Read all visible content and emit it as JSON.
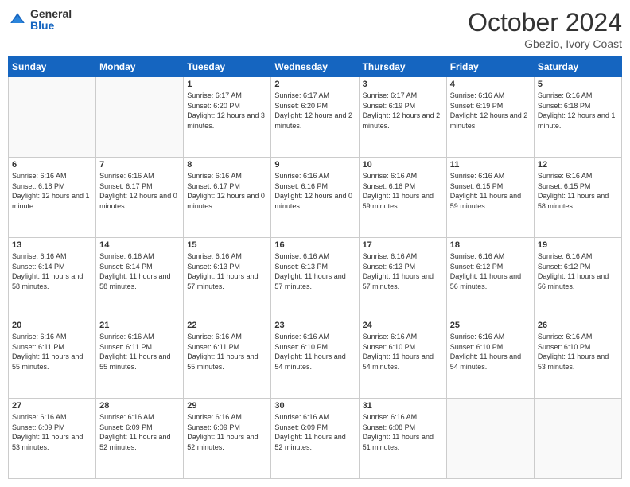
{
  "header": {
    "logo_general": "General",
    "logo_blue": "Blue",
    "month_title": "October 2024",
    "subtitle": "Gbezio, Ivory Coast"
  },
  "weekdays": [
    "Sunday",
    "Monday",
    "Tuesday",
    "Wednesday",
    "Thursday",
    "Friday",
    "Saturday"
  ],
  "weeks": [
    [
      {
        "day": "",
        "empty": true
      },
      {
        "day": "",
        "empty": true
      },
      {
        "day": "1",
        "sunrise": "6:17 AM",
        "sunset": "6:20 PM",
        "daylight": "12 hours and 3 minutes."
      },
      {
        "day": "2",
        "sunrise": "6:17 AM",
        "sunset": "6:20 PM",
        "daylight": "12 hours and 2 minutes."
      },
      {
        "day": "3",
        "sunrise": "6:17 AM",
        "sunset": "6:19 PM",
        "daylight": "12 hours and 2 minutes."
      },
      {
        "day": "4",
        "sunrise": "6:16 AM",
        "sunset": "6:19 PM",
        "daylight": "12 hours and 2 minutes."
      },
      {
        "day": "5",
        "sunrise": "6:16 AM",
        "sunset": "6:18 PM",
        "daylight": "12 hours and 1 minute."
      }
    ],
    [
      {
        "day": "6",
        "sunrise": "6:16 AM",
        "sunset": "6:18 PM",
        "daylight": "12 hours and 1 minute."
      },
      {
        "day": "7",
        "sunrise": "6:16 AM",
        "sunset": "6:17 PM",
        "daylight": "12 hours and 0 minutes."
      },
      {
        "day": "8",
        "sunrise": "6:16 AM",
        "sunset": "6:17 PM",
        "daylight": "12 hours and 0 minutes."
      },
      {
        "day": "9",
        "sunrise": "6:16 AM",
        "sunset": "6:16 PM",
        "daylight": "12 hours and 0 minutes."
      },
      {
        "day": "10",
        "sunrise": "6:16 AM",
        "sunset": "6:16 PM",
        "daylight": "11 hours and 59 minutes."
      },
      {
        "day": "11",
        "sunrise": "6:16 AM",
        "sunset": "6:15 PM",
        "daylight": "11 hours and 59 minutes."
      },
      {
        "day": "12",
        "sunrise": "6:16 AM",
        "sunset": "6:15 PM",
        "daylight": "11 hours and 58 minutes."
      }
    ],
    [
      {
        "day": "13",
        "sunrise": "6:16 AM",
        "sunset": "6:14 PM",
        "daylight": "11 hours and 58 minutes."
      },
      {
        "day": "14",
        "sunrise": "6:16 AM",
        "sunset": "6:14 PM",
        "daylight": "11 hours and 58 minutes."
      },
      {
        "day": "15",
        "sunrise": "6:16 AM",
        "sunset": "6:13 PM",
        "daylight": "11 hours and 57 minutes."
      },
      {
        "day": "16",
        "sunrise": "6:16 AM",
        "sunset": "6:13 PM",
        "daylight": "11 hours and 57 minutes."
      },
      {
        "day": "17",
        "sunrise": "6:16 AM",
        "sunset": "6:13 PM",
        "daylight": "11 hours and 57 minutes."
      },
      {
        "day": "18",
        "sunrise": "6:16 AM",
        "sunset": "6:12 PM",
        "daylight": "11 hours and 56 minutes."
      },
      {
        "day": "19",
        "sunrise": "6:16 AM",
        "sunset": "6:12 PM",
        "daylight": "11 hours and 56 minutes."
      }
    ],
    [
      {
        "day": "20",
        "sunrise": "6:16 AM",
        "sunset": "6:11 PM",
        "daylight": "11 hours and 55 minutes."
      },
      {
        "day": "21",
        "sunrise": "6:16 AM",
        "sunset": "6:11 PM",
        "daylight": "11 hours and 55 minutes."
      },
      {
        "day": "22",
        "sunrise": "6:16 AM",
        "sunset": "6:11 PM",
        "daylight": "11 hours and 55 minutes."
      },
      {
        "day": "23",
        "sunrise": "6:16 AM",
        "sunset": "6:10 PM",
        "daylight": "11 hours and 54 minutes."
      },
      {
        "day": "24",
        "sunrise": "6:16 AM",
        "sunset": "6:10 PM",
        "daylight": "11 hours and 54 minutes."
      },
      {
        "day": "25",
        "sunrise": "6:16 AM",
        "sunset": "6:10 PM",
        "daylight": "11 hours and 54 minutes."
      },
      {
        "day": "26",
        "sunrise": "6:16 AM",
        "sunset": "6:10 PM",
        "daylight": "11 hours and 53 minutes."
      }
    ],
    [
      {
        "day": "27",
        "sunrise": "6:16 AM",
        "sunset": "6:09 PM",
        "daylight": "11 hours and 53 minutes."
      },
      {
        "day": "28",
        "sunrise": "6:16 AM",
        "sunset": "6:09 PM",
        "daylight": "11 hours and 52 minutes."
      },
      {
        "day": "29",
        "sunrise": "6:16 AM",
        "sunset": "6:09 PM",
        "daylight": "11 hours and 52 minutes."
      },
      {
        "day": "30",
        "sunrise": "6:16 AM",
        "sunset": "6:09 PM",
        "daylight": "11 hours and 52 minutes."
      },
      {
        "day": "31",
        "sunrise": "6:16 AM",
        "sunset": "6:08 PM",
        "daylight": "11 hours and 51 minutes."
      },
      {
        "day": "",
        "empty": true
      },
      {
        "day": "",
        "empty": true
      }
    ]
  ],
  "labels": {
    "sunrise_prefix": "Sunrise: ",
    "sunset_prefix": "Sunset: ",
    "daylight_prefix": "Daylight: "
  }
}
